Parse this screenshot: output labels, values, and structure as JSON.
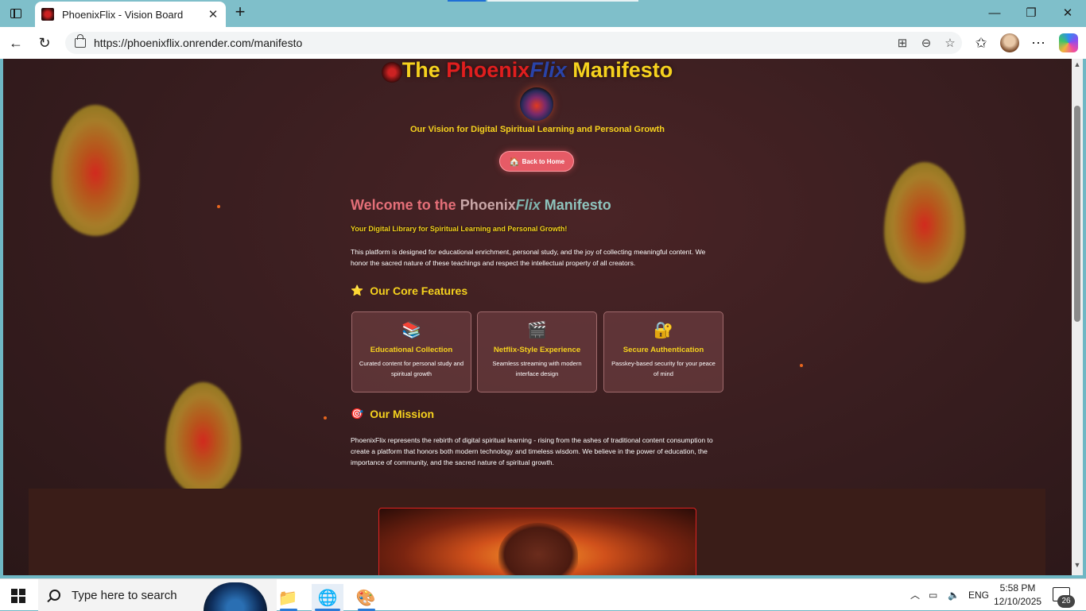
{
  "browser": {
    "tab_title": "PhoenixFlix - Vision Board",
    "tab_close": "✕",
    "new_tab": "+",
    "url": "https://phoenixflix.onrender.com/manifesto",
    "window_controls": {
      "minimize": "—",
      "maximize": "❐",
      "close": "✕"
    }
  },
  "page": {
    "title_the": "The ",
    "title_phoenix": "Phoenix",
    "title_flix": "Flix",
    "title_manifesto": " Manifesto",
    "subtitle": "Our Vision for Digital Spiritual Learning and Personal Growth",
    "back_button": "Back to Home",
    "welcome": {
      "w1": "Welcome to the ",
      "w2": "Phoenix",
      "w3": "Flix",
      "w4": " Manifesto"
    },
    "tagline": "Your Digital Library for Spiritual Learning and Personal Growth!",
    "intro": "This platform is designed for educational enrichment, personal study, and the joy of collecting meaningful content. We honor the sacred nature of these teachings and respect the intellectual property of all creators.",
    "features_heading": "Our Core Features",
    "features": [
      {
        "icon": "📚",
        "title": "Educational Collection",
        "desc": "Curated content for personal study and spiritual growth"
      },
      {
        "icon": "🎬",
        "title": "Netflix-Style Experience",
        "desc": "Seamless streaming with modern interface design"
      },
      {
        "icon": "🔐",
        "title": "Secure Authentication",
        "desc": "Passkey-based security for your peace of mind"
      }
    ],
    "mission_heading": "Our Mission",
    "mission": "PhoenixFlix represents the rebirth of digital spiritual learning - rising from the ashes of traditional content consumption to create a platform that honors both modern technology and timeless wisdom. We believe in the power of education, the importance of community, and the sacred nature of spiritual growth."
  },
  "taskbar": {
    "search_placeholder": "Type here to search",
    "language": "ENG",
    "time": "5:58 PM",
    "date": "12/10/2025",
    "notification_count": "26"
  },
  "colors": {
    "accent_yellow": "#f6d21e",
    "accent_red": "#e01e1e",
    "accent_blue": "#2a43a8",
    "back_button": "#e65b66"
  }
}
